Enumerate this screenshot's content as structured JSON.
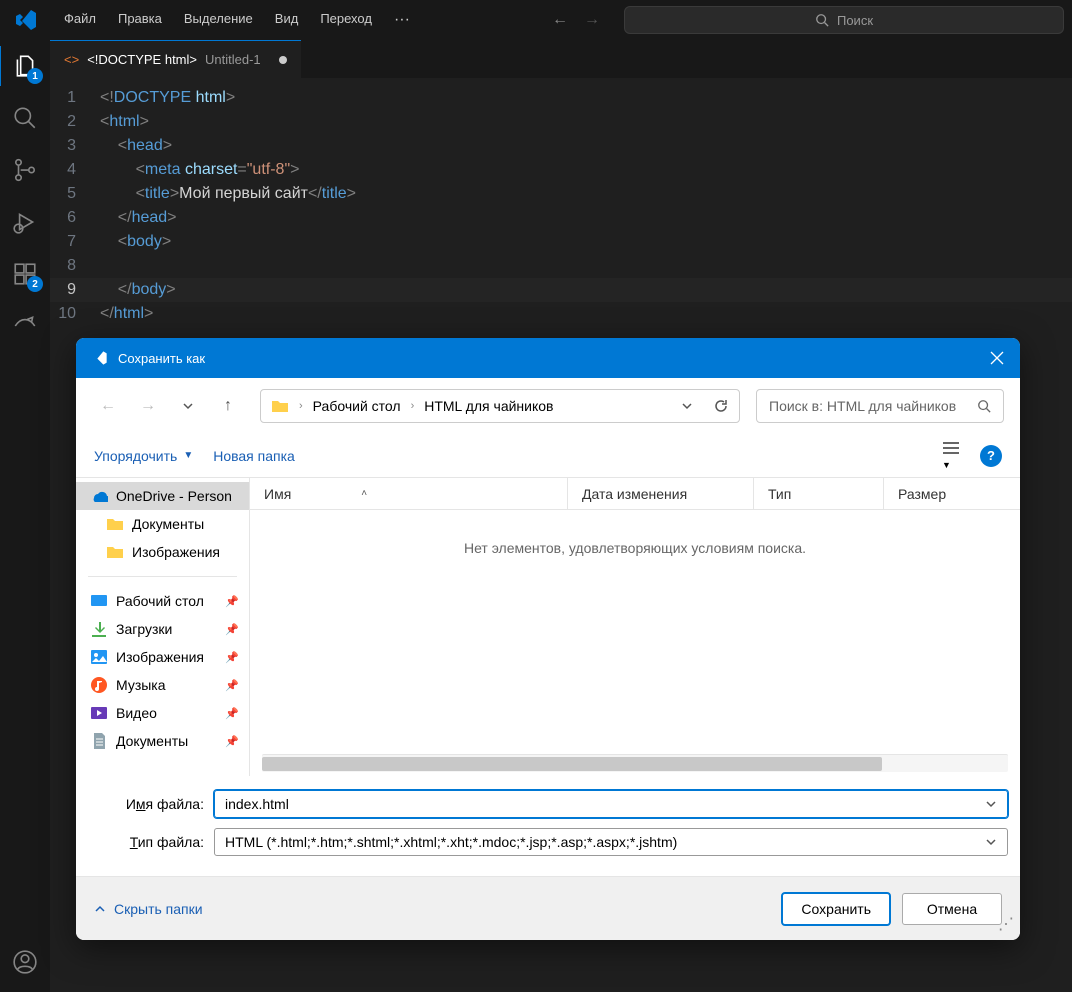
{
  "menu": {
    "items": [
      "Файл",
      "Правка",
      "Выделение",
      "Вид",
      "Переход"
    ],
    "more": "···"
  },
  "search": {
    "placeholder": "Поиск"
  },
  "activity": {
    "explorer_badge": "1",
    "extensions_badge": "2"
  },
  "tab": {
    "title": "<!DOCTYPE html>",
    "subtitle": "Untitled-1"
  },
  "code": {
    "line_numbers": [
      "1",
      "2",
      "3",
      "4",
      "5",
      "6",
      "7",
      "8",
      "9",
      "10"
    ],
    "text_line5": "Мой первый сайт"
  },
  "dialog": {
    "title": "Сохранить как",
    "breadcrumb": {
      "part1": "Рабочий стол",
      "part2": "HTML для чайников"
    },
    "search_placeholder": "Поиск в: HTML для чайников",
    "toolbar": {
      "organize": "Упорядочить",
      "new_folder": "Новая папка"
    },
    "tree": {
      "onedrive": "OneDrive - Person",
      "onedrive_docs": "Документы",
      "onedrive_imgs": "Изображения",
      "desktop": "Рабочий стол",
      "downloads": "Загрузки",
      "pictures": "Изображения",
      "music": "Музыка",
      "video": "Видео",
      "documents": "Документы"
    },
    "columns": {
      "name": "Имя",
      "date": "Дата изменения",
      "type": "Тип",
      "size": "Размер"
    },
    "empty": "Нет элементов, удовлетворяющих условиям поиска.",
    "filename_label_pre": "И",
    "filename_label_u": "м",
    "filename_label_post": "я файла:",
    "filetype_label_pre": "",
    "filetype_label_u": "Т",
    "filetype_label_post": "ип файла:",
    "filename": "index.html",
    "filetype": "HTML (*.html;*.htm;*.shtml;*.xhtml;*.xht;*.mdoc;*.jsp;*.asp;*.aspx;*.jshtm)",
    "hide_folders": "Скрыть папки",
    "save": "Сохранить",
    "cancel": "Отмена"
  }
}
